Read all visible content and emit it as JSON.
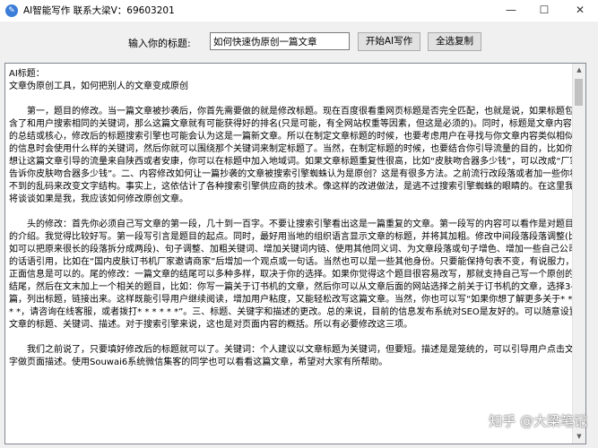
{
  "window": {
    "title": "AI智能写作 联系大梁V：69603201",
    "app_icon": "app-icon",
    "controls": {
      "minimize": "—",
      "maximize": "☐",
      "close": "✕"
    }
  },
  "toolbar": {
    "topic_label": "输入你的标题:",
    "topic_value": "如何快速伪原创一篇文章",
    "start_button": "开始AI写作",
    "copy_button": "全选复制"
  },
  "content": {
    "lines": [
      "AI标题：",
      "文章伪原创工具，如何把别人的文章变成原创",
      "",
      "　　第一，题目的修改。当一篇文章被抄袭后，你首先需要做的就是修改标题。现在百度很看重网页标题是否完全匹配，也就是说，如果标题包含了和用户搜索相同的关键词，那么这篇文章就有可能获得好的排名(只是可能，有全网站权重等因素，但这是必须的)。同时，标题是文章内容的总结或核心，修改后的标题搜索引擎也可能会认为这是一篇新文章。所以在制定文章标题的时候，也要考虑用户在寻找与你文章内容类似相似的信息时会使用什么样的关键词，然后你就可以围绕那个关键词来制定标题了。当然，在制定标题的时候，也要结合你引导流量的目的，比如你想让这篇文章引导的流量来自陕西或者安康，你可以在标题中加入地域词。如果文章标题重复性很高，比如“皮肤吻合器多少钱”，可以改成“厂家告诉你皮肤吻合器多少钱”。二、内容修改如何让一篇抄袭的文章被搜索引擎蜘蛛认为是原创？这是有很多方法。之前流行改段落或者加一些你看不到的乱码来改变文字结构。事实上，这依估计了各种搜索引擎供应商的技术。像这样的改进做法，是逃不过搜索引擎蜘蛛的眼睛的。在这里我将谈谈如果是我，我应该如何修改原创文章。",
      "",
      "　　头的修改：首先你必须自己写文章的第一段，几十到一百字。不要让搜索引擎看出这是一篇重复的文章。第一段写的内容可以看作是对题目的介绍。我觉得比较好写。第一段写引言是题目的起点。同时，最好用当地的组织语言显示文章的标题，并将其加粗。修改中间段落段落调整(比如可以把原来很长的段落拆分成两段)、句子调整、加粗关键词、增加关键词内链、使用其他同义词、为文章段落或句子增色、增加一些自己公司的话语引用，比如在“国内皮肤订书机厂家邀请商家”后增加一个观点或一句话。当然也可以是一些其他身份。只要能保持句表不变，有说服力，正面信息是可以的。尾的修改：一篇文章的结尾可以多种多样，取决于你的选择。如果你觉得这个题目很容易改写，那就支持自己写一个原创的结尾，然后在文末加上一个相关的题目，比如：你写一篇关于订书机的文章，然后你可以从文章后面的网站选择之前关于订书机的文章，选择3-6篇，列出标题，链接出来。这样既能引导用户继续阅读，增加用户粘度，又能轻松改写这篇文章。当然，你也可以写“如果你想了解更多关于* * * * *，请咨询在线客服，或者拨打* * * * * *”。三、标题、关键字和描述的更改。总的来说，目前的信息发布系统对SEO是友好的。可以随意设置文章的标题、关键词、描述。对于搜索引擎来说，这也是对页面内容的概括。所以有必要修改这三项。",
      "",
      "　　我们之前说了，只要填好修改后的标题就可以了。关键词：个人建议以文章标题为关键词，但要短。描述是是笼统的，可以引导用户点击文字做页面描述。使用Souwai6系统微信集客的同学也可以看看这篇文章，希望对大家有所帮助。"
    ]
  },
  "scrollbar": {
    "up_arrow": "▲",
    "down_arrow": "▼"
  },
  "watermark": "知乎 @大梁笔记"
}
